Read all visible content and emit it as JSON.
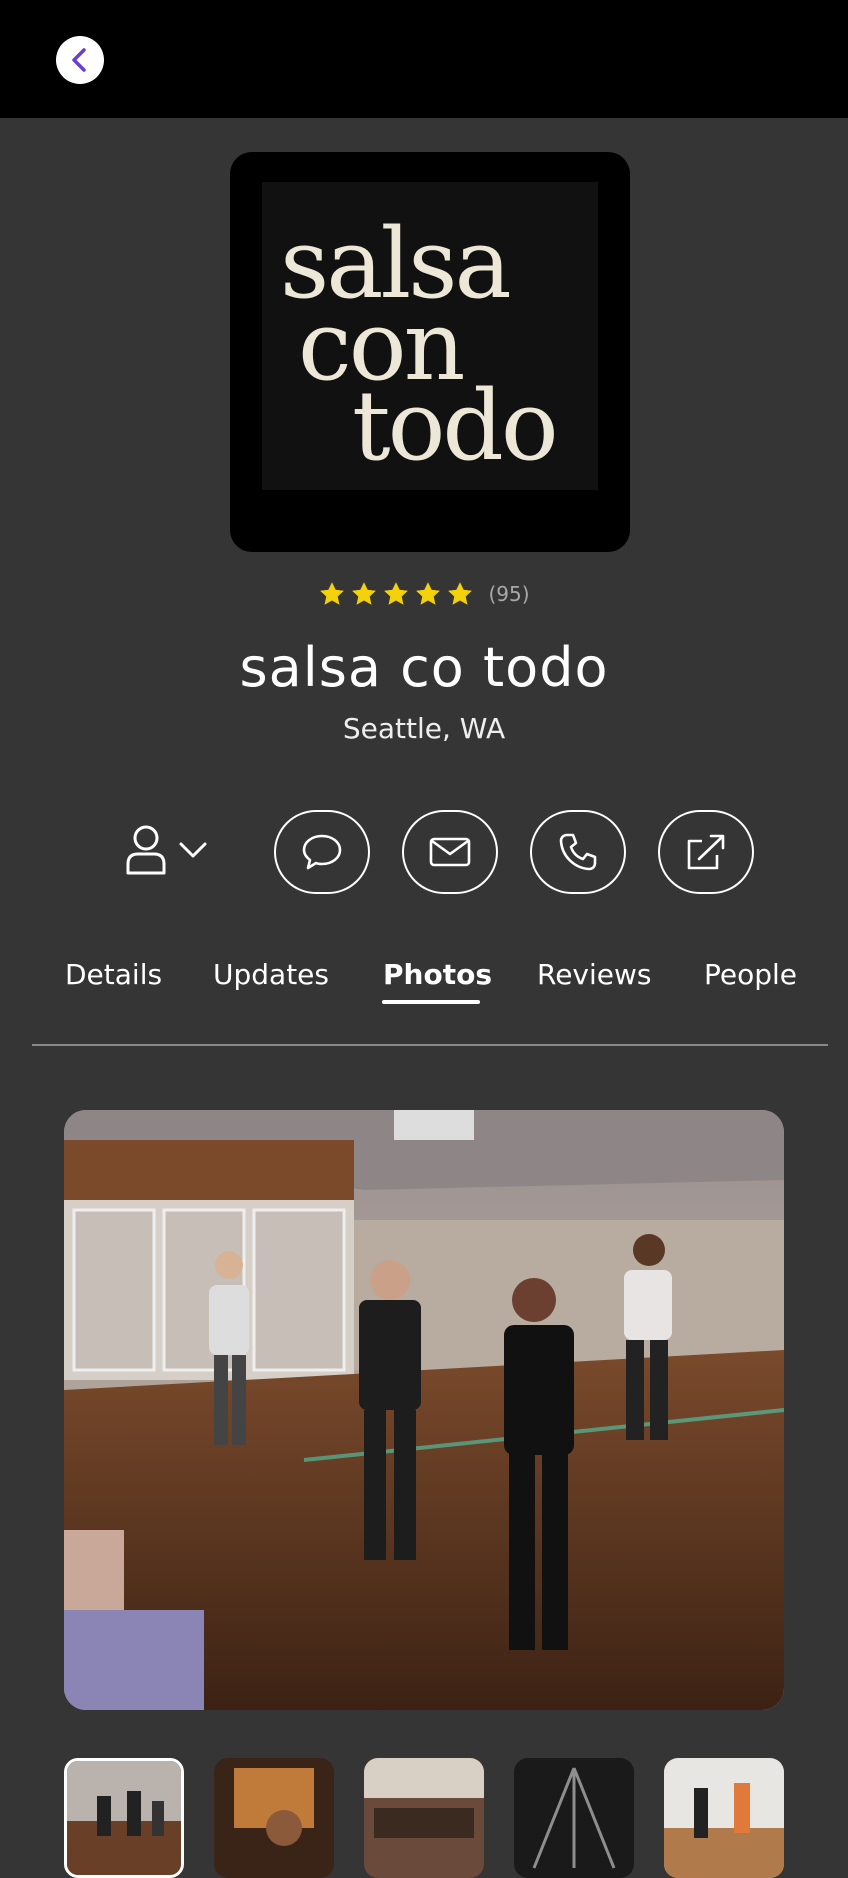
{
  "header": {
    "back_icon": "chevron-left-icon"
  },
  "profile": {
    "logo_lines": [
      "salsa",
      "con",
      "todo"
    ],
    "rating": 5,
    "rating_count": "(95)",
    "name": "salsa co todo",
    "location": "Seattle, WA"
  },
  "actions": {
    "user_icon": "user-icon",
    "dropdown_icon": "chevron-down-icon",
    "buttons": [
      "chat-bubble-icon",
      "mail-icon",
      "phone-icon",
      "share-icon"
    ]
  },
  "tabs": {
    "items": [
      "Details",
      "Updates",
      "Photos",
      "Reviews",
      "People"
    ],
    "active": "Photos"
  },
  "colors": {
    "background": "#353535",
    "topbar": "#000000",
    "accent": "#6a3fd0",
    "star": "#f5d10a"
  }
}
